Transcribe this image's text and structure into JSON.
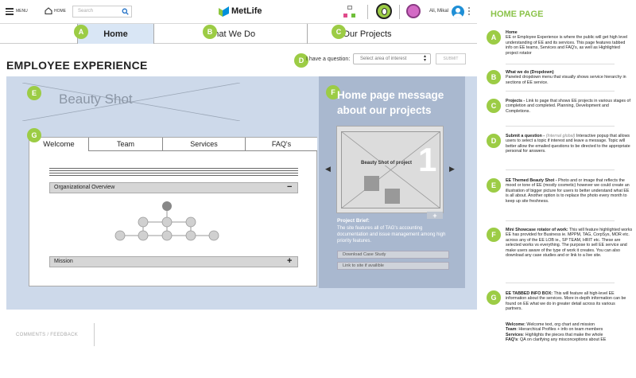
{
  "topbar": {
    "menu_label": "MENU",
    "home_label": "HOME",
    "search_placeholder": "Search",
    "brand": "MetLife",
    "user_name": "Ali, Mikal"
  },
  "nav": {
    "tabs": [
      {
        "badge": "A",
        "label": "Home"
      },
      {
        "badge": "B",
        "label": "What We Do"
      },
      {
        "badge": "C",
        "label": "Our Projects"
      }
    ]
  },
  "page": {
    "title": "EMPLOYEE EXPERIENCE",
    "question_badge": "D",
    "question_label": "I have a question:",
    "question_select": "Select area of interest",
    "submit_label": "SUBMIT"
  },
  "hero": {
    "badge": "E",
    "beauty_shot": "Beauty Shot"
  },
  "tabs_box": {
    "badge": "G",
    "tabs": [
      "Welcome",
      "Team",
      "Services",
      "FAQ's"
    ],
    "accordion": [
      {
        "label": "Organizational Overview",
        "toggle": "−"
      },
      {
        "label": "Mission",
        "toggle": "+"
      }
    ]
  },
  "project_panel": {
    "badge": "F",
    "message": "Home page message about our projects",
    "image_label": "Beauty Shot of project",
    "slide_number": "1",
    "expand": "+",
    "brief_title": "Project Brief:",
    "brief_text": "The site features all of TAG's accounting documentation and issue management among high priority features.",
    "download_label": "Download Case Study",
    "link_label": "Link to site if availible"
  },
  "footer": {
    "comments_label": "COMMENTS / FEEDBACK"
  },
  "notes": {
    "title": "HOME PAGE",
    "items": [
      {
        "badge": "A",
        "title": "Home",
        "body": "EE or Employee Experience is where the public will get high level understanding of EE and its services. This page features tabbed info on EE teams, Services and FAQ's, as well as Highlighted project rotator"
      },
      {
        "badge": "B",
        "title": "What we do (Dropdown)",
        "body": "Paneled dropdown menu that visually shows service hierarchy in sections of EE service."
      },
      {
        "badge": "C",
        "title": "Projects - ",
        "body": "Link to page that shows EE projects in various stages of completion and completed. Planning, Development and Completions."
      },
      {
        "badge": "D",
        "title": "Submit a question - ",
        "italic": "(Internal global)",
        "body": " Interactive popup that allows users to select a topic if interest and leave a message. Topic will better allow the emailed questions to be directed to the appropriate personal for answers."
      },
      {
        "badge": "E",
        "title": "EE Themed Beauty Shot - ",
        "body": "Photo and or image that reflects the mood or tone of EE (mostly cosmetic) however we could create an illustration of bigger picture for users to better understand what EE is all about. Another option is to replace the photo every month to keep up site freshness."
      },
      {
        "badge": "F",
        "title": "Mini Showcase rotator of work:",
        "body": " This will feature highlighted works EE has provided for Business ie. MPPM, TAG, CorpSys, MOR etc. across any of the EE LOB ie., SP TEAM, HRIT etc. These are selected works vs everything. The purpose to sell EE service and make users aware of the type of work it creates. You can also download any case studies and or link to a live site."
      },
      {
        "badge": "G",
        "title": "EE TABBED INFO BOX:",
        "body": " This will feature all high-level EE information about the services. More in-depth information can be found on EE what we do in greater detail across its various partners."
      }
    ],
    "tab_notes": [
      {
        "title": "Welcome:",
        "body": " Welcome text, org chart and mission"
      },
      {
        "title": "Team",
        "body": ": Hierarchical Profiles + info on team members"
      },
      {
        "title": "Services",
        "body": ": Highlights the pieces that make the whole"
      },
      {
        "title": "FAQ's",
        "body": ": QA on clarifying any misconceptions about EE"
      }
    ]
  },
  "colors": {
    "badge": "#9ccc45",
    "hero_bg": "#cdd9ea",
    "panel_bg": "#a9b8cf",
    "notes_title": "#8bc34a",
    "brand_text": "#1a1a1a"
  }
}
